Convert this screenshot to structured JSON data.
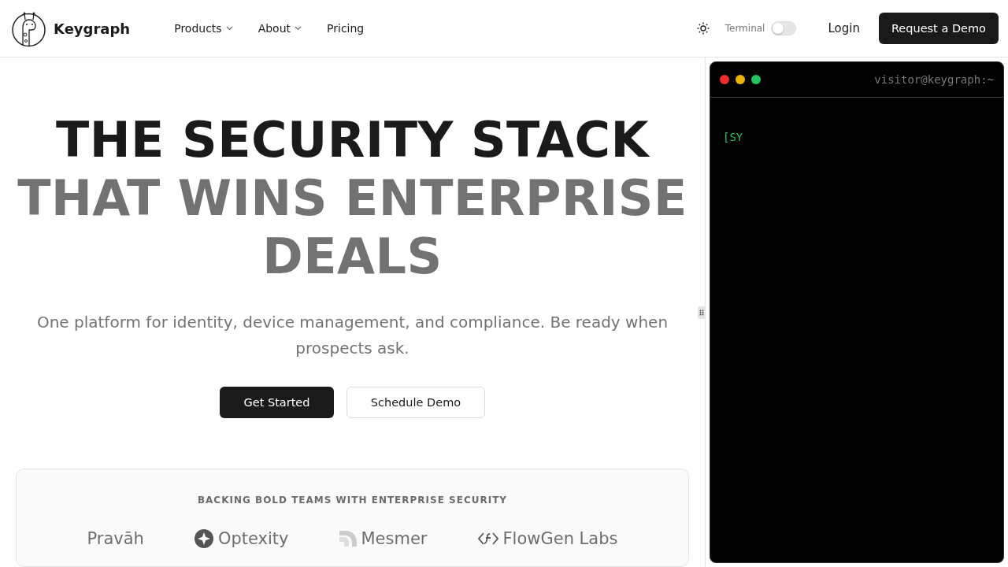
{
  "header": {
    "brand": "Keygraph",
    "nav": [
      {
        "label": "Products",
        "dropdown": true
      },
      {
        "label": "About",
        "dropdown": true
      },
      {
        "label": "Pricing",
        "dropdown": false
      }
    ],
    "terminal_toggle": {
      "label": "Terminal",
      "on": false
    },
    "login": "Login",
    "cta": "Request a Demo"
  },
  "hero": {
    "title_dark": "THE SECURITY STACK",
    "title_muted": "THAT WINS ENTERPRISE DEALS",
    "subtitle": "One platform for identity, device management, and compliance. Be ready when prospects ask.",
    "primary": "Get Started",
    "secondary": "Schedule Demo"
  },
  "backers": {
    "heading": "BACKING BOLD TEAMS WITH ENTERPRISE SECURITY",
    "logos": [
      {
        "name": "Pravāh",
        "kind": "plain"
      },
      {
        "name": "Optexity",
        "kind": "circle"
      },
      {
        "name": "Mesmer",
        "kind": "arrow"
      },
      {
        "name": "FlowGen Labs",
        "kind": "code"
      }
    ]
  },
  "terminal": {
    "prompt": "visitor@keygraph:~",
    "output": "[SY"
  }
}
